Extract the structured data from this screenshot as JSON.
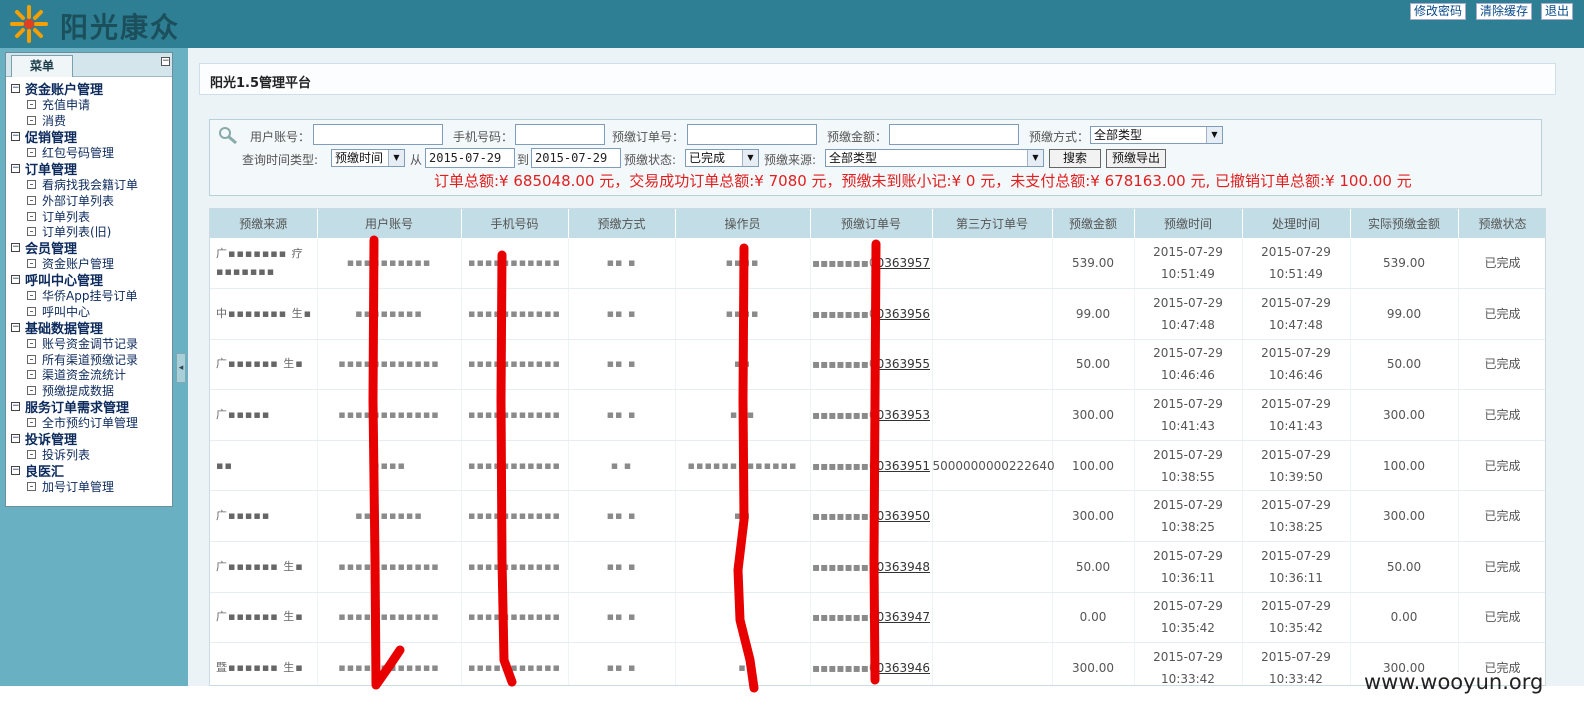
{
  "header": {
    "logo_text": "阳光康众",
    "buttons": [
      "修改密码",
      "清除缓存",
      "退出"
    ]
  },
  "menu": {
    "tab_label": "菜单",
    "collapse_glyph": "−",
    "groups": [
      {
        "label": "资金账户管理",
        "items": [
          "充值申请",
          "消费"
        ]
      },
      {
        "label": "促销管理",
        "items": [
          "红包号码管理"
        ]
      },
      {
        "label": "订单管理",
        "items": [
          "看病找我会籍订单",
          "外部订单列表",
          "订单列表",
          "订单列表(旧)"
        ]
      },
      {
        "label": "会员管理",
        "items": [
          "资金账户管理"
        ]
      },
      {
        "label": "呼叫中心管理",
        "items": [
          "华侨App挂号订单",
          "呼叫中心"
        ]
      },
      {
        "label": "基础数据管理",
        "items": [
          "账号资金调节记录",
          "所有渠道预缴记录",
          "渠道资金流统计",
          "预缴提成数据"
        ]
      },
      {
        "label": "服务订单需求管理",
        "items": [
          "全市预约订单管理"
        ]
      },
      {
        "label": "投诉管理",
        "items": [
          "投诉列表"
        ]
      },
      {
        "label": "良医汇",
        "items": [
          "加号订单管理"
        ]
      }
    ]
  },
  "page": {
    "title": "阳光1.5管理平台"
  },
  "search": {
    "user_account_label": "用户账号：",
    "phone_label": "手机号码：",
    "prepay_order_label": "预缴订单号：",
    "prepay_amount_label": "预缴金额：",
    "prepay_method_label": "预缴方式：",
    "prepay_method_value": "全部类型",
    "time_type_label": "查询时间类型:",
    "time_type_value": "预缴时间",
    "from_label": "从",
    "from_date": "2015-07-29",
    "to_label": "到",
    "to_date": "2015-07-29",
    "status_label": "预缴状态:",
    "status_value": "已完成",
    "source_label": "预缴来源:",
    "source_value": "全部类型",
    "search_button": "搜索",
    "export_button": "预缴导出",
    "summary": "订单总额:¥ 685048.00 元，交易成功订单总额:¥ 7080 元，预缴未到账小记:¥ 0 元，未支付总额:¥ 678163.00 元, 已撤销订单总额:¥ 100.00 元"
  },
  "table": {
    "columns": [
      "预缴来源",
      "用户账号",
      "手机号码",
      "预缴方式",
      "操作员",
      "预缴订单号",
      "第三方订单号",
      "预缴金额",
      "预缴时间",
      "处理时间",
      "实际预缴金额",
      "预缴状态"
    ],
    "rows": [
      {
        "source": "广▪▪▪▪▪▪▪ 疗▪▪▪▪▪▪▪",
        "account": "▪▪▪▪▪▪▪▪▪▪",
        "phone": "▪▪▪▪▪▪▪▪▪▪▪",
        "method": "▪▪ ▪",
        "operator": "▪▪▪▪",
        "order_prefix": "▪▪▪▪▪▪▪0",
        "order_suffix": "0363957",
        "third": "",
        "amount": "539.00",
        "prepay_date": "2015-07-29",
        "prepay_time": "10:51:49",
        "proc_date": "2015-07-29",
        "proc_time": "10:51:49",
        "actual": "539.00",
        "status": "已完成"
      },
      {
        "source": "中▪▪▪▪▪▪▪ 生▪",
        "account": "▪▪▪▪▪▪▪▪",
        "phone": "▪▪▪▪▪▪▪▪▪▪▪",
        "method": "▪▪ ▪",
        "operator": "▪▪▪▪",
        "order_prefix": "▪▪▪▪▪▪▪0",
        "order_suffix": "0363956",
        "third": "",
        "amount": "99.00",
        "prepay_date": "2015-07-29",
        "prepay_time": "10:47:48",
        "proc_date": "2015-07-29",
        "proc_time": "10:47:48",
        "actual": "99.00",
        "status": "已完成"
      },
      {
        "source": "广▪▪▪▪▪▪ 生▪",
        "account": "▪▪▪▪▪▪▪▪▪▪▪▪",
        "phone": "▪▪▪▪▪▪▪▪▪▪▪",
        "method": "▪▪ ▪",
        "operator": "▪▪",
        "order_prefix": "▪▪▪▪▪▪▪0",
        "order_suffix": "0363955",
        "third": "",
        "amount": "50.00",
        "prepay_date": "2015-07-29",
        "prepay_time": "10:46:46",
        "proc_date": "2015-07-29",
        "proc_time": "10:46:46",
        "actual": "50.00",
        "status": "已完成"
      },
      {
        "source": "广▪▪▪▪▪",
        "account": "▪▪▪▪▪▪▪▪▪▪▪▪",
        "phone": "▪▪▪▪▪▪▪▪▪▪▪",
        "method": "▪▪ ▪",
        "operator": "▪▪▪",
        "order_prefix": "▪▪▪▪▪▪▪0",
        "order_suffix": "0363953",
        "third": "",
        "amount": "300.00",
        "prepay_date": "2015-07-29",
        "prepay_time": "10:41:43",
        "proc_date": "2015-07-29",
        "proc_time": "10:41:43",
        "actual": "300.00",
        "status": "已完成"
      },
      {
        "source": "▪▪",
        "account": "▪▪▪▪",
        "phone": "▪▪▪▪▪▪▪▪▪▪▪",
        "method": "▪ ▪",
        "operator": "▪▪▪▪▪▪▪▪▪▪▪▪▪",
        "order_prefix": "▪▪▪▪▪▪▪0",
        "order_suffix": "0363951",
        "third": "5000000000222640",
        "amount": "100.00",
        "prepay_date": "2015-07-29",
        "prepay_time": "10:38:55",
        "proc_date": "2015-07-29",
        "proc_time": "10:39:50",
        "actual": "100.00",
        "status": "已完成"
      },
      {
        "source": "广▪▪▪▪▪",
        "account": "▪▪▪▪▪▪▪▪",
        "phone": "▪▪▪▪▪▪▪▪▪▪▪",
        "method": "▪▪ ▪",
        "operator": "▪▪",
        "order_prefix": "▪▪▪▪▪▪▪0",
        "order_suffix": "0363950",
        "third": "",
        "amount": "300.00",
        "prepay_date": "2015-07-29",
        "prepay_time": "10:38:25",
        "proc_date": "2015-07-29",
        "proc_time": "10:38:25",
        "actual": "300.00",
        "status": "已完成"
      },
      {
        "source": "广▪▪▪▪▪▪ 生▪",
        "account": "▪▪▪▪▪▪▪▪▪▪▪▪",
        "phone": "▪▪▪▪▪▪▪▪▪▪▪",
        "method": "▪▪ ▪",
        "operator": "",
        "order_prefix": "▪▪▪▪▪▪▪0",
        "order_suffix": "0363948",
        "third": "",
        "amount": "50.00",
        "prepay_date": "2015-07-29",
        "prepay_time": "10:36:11",
        "proc_date": "2015-07-29",
        "proc_time": "10:36:11",
        "actual": "50.00",
        "status": "已完成"
      },
      {
        "source": "广▪▪▪▪▪▪ 生▪",
        "account": "▪▪▪▪▪▪▪▪▪▪▪▪",
        "phone": "▪▪▪▪▪▪▪▪▪▪▪",
        "method": "▪▪ ▪",
        "operator": "",
        "order_prefix": "▪▪▪▪▪▪▪0",
        "order_suffix": "0363947",
        "third": "",
        "amount": "0.00",
        "prepay_date": "2015-07-29",
        "prepay_time": "10:35:42",
        "proc_date": "2015-07-29",
        "proc_time": "10:35:42",
        "actual": "0.00",
        "status": "已完成"
      },
      {
        "source": "暨▪▪▪▪▪▪ 生▪",
        "account": "▪▪▪▪▪▪▪▪▪▪▪▪",
        "phone": "▪▪▪▪▪▪▪▪▪▪▪",
        "method": "▪▪ ▪",
        "operator": "▪",
        "order_prefix": "▪▪▪▪▪▪▪0",
        "order_suffix": "0363946",
        "third": "",
        "amount": "300.00",
        "prepay_date": "2015-07-29",
        "prepay_time": "10:33:42",
        "proc_date": "2015-07-29",
        "proc_time": "10:33:42",
        "actual": "300.00",
        "status": "已完成"
      }
    ]
  },
  "colors": {
    "header_bg": "#2e7f93",
    "left_frame_bg": "#6ab0c3",
    "table_header_bg": "#c2dde6",
    "summary_red": "#e02020",
    "annotation_red": "#e80000"
  },
  "watermark": "www.wooyun.org"
}
